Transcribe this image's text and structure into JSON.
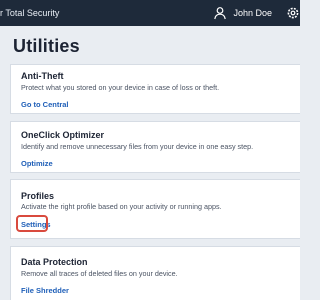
{
  "app": {
    "title": "r Total Security"
  },
  "user": {
    "name": "John Doe",
    "icon": "person-icon",
    "settings_icon": "gear-icon"
  },
  "page": {
    "title": "Utilities"
  },
  "colors": {
    "topbar": "#1e2a3a",
    "link": "#1f5fb8",
    "highlight": "#d94a3e",
    "background": "#e9edf2"
  },
  "cards": [
    {
      "title": "Anti-Theft",
      "description": "Protect what you stored on your device in case of loss or theft.",
      "link": "Go to Central"
    },
    {
      "title": "OneClick Optimizer",
      "description": "Identify and remove unnecessary files from your device in one easy step.",
      "link": "Optimize"
    },
    {
      "title": "Profiles",
      "description": "Activate the right profile based on your activity or running apps.",
      "link": "Settings"
    },
    {
      "title": "Data Protection",
      "description": "Remove all traces of deleted files on your device.",
      "link": "File Shredder"
    }
  ]
}
